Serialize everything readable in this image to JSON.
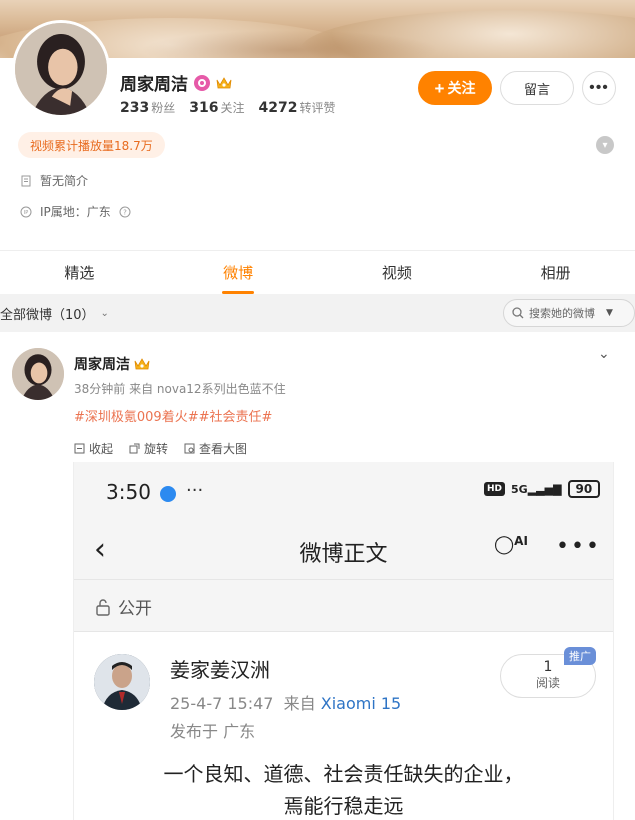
{
  "profile": {
    "name": "周家周洁",
    "stats": [
      {
        "value": "233",
        "label": "粉丝"
      },
      {
        "value": "316",
        "label": "关注"
      },
      {
        "value": "4272",
        "label": "转评赞"
      }
    ],
    "follow_label": "关注",
    "message_label": "留言",
    "more_label": "•••",
    "video_plays": "视频累计播放量18.7万",
    "bio": "暂无简介",
    "ip": "IP属地：广东"
  },
  "tabs": [
    "精选",
    "微博",
    "视频",
    "相册"
  ],
  "filter": {
    "label": "全部微博（10）",
    "search_placeholder": "搜索她的微博"
  },
  "post": {
    "author": "周家周洁",
    "meta": "38分钟前  来自 nova12系列出色蓝不住",
    "tags": "#深圳极氪009着火##社会责任#",
    "actions": [
      "收起",
      "旋转",
      "查看大图"
    ]
  },
  "screenshot": {
    "time": "3:50",
    "dots": "···",
    "network": "5G",
    "battery": "90",
    "hd": "HD",
    "nav_title": "微博正文",
    "ai_label": "AI",
    "public_label": "公开",
    "author": "姜家姜汉洲",
    "date": "25-4-7 15:47",
    "from_label": "来自",
    "device": "Xiaomi 15",
    "location": "发布于 广东",
    "reads": "1",
    "reads_label": "阅读",
    "ad_label": "推广",
    "text_line1": "一个良知、道德、社会责任缺失的企业，",
    "text_line2": "焉能行稳走远"
  },
  "colors": {
    "accent": "#ff8200",
    "tag": "#eb7350",
    "link_blue": "#2e74c5"
  }
}
